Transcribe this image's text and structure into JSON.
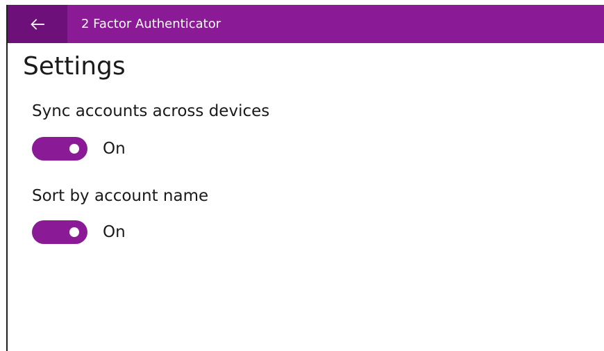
{
  "titlebar": {
    "back_icon": "back-arrow-icon",
    "app_title": "2 Factor Authenticator",
    "accent_color": "#8a1a96",
    "back_button_color": "#6d1079"
  },
  "page": {
    "title": "Settings"
  },
  "settings": [
    {
      "label": "Sync accounts across devices",
      "state": "On",
      "enabled": true
    },
    {
      "label": "Sort by account name",
      "state": "On",
      "enabled": true
    }
  ]
}
